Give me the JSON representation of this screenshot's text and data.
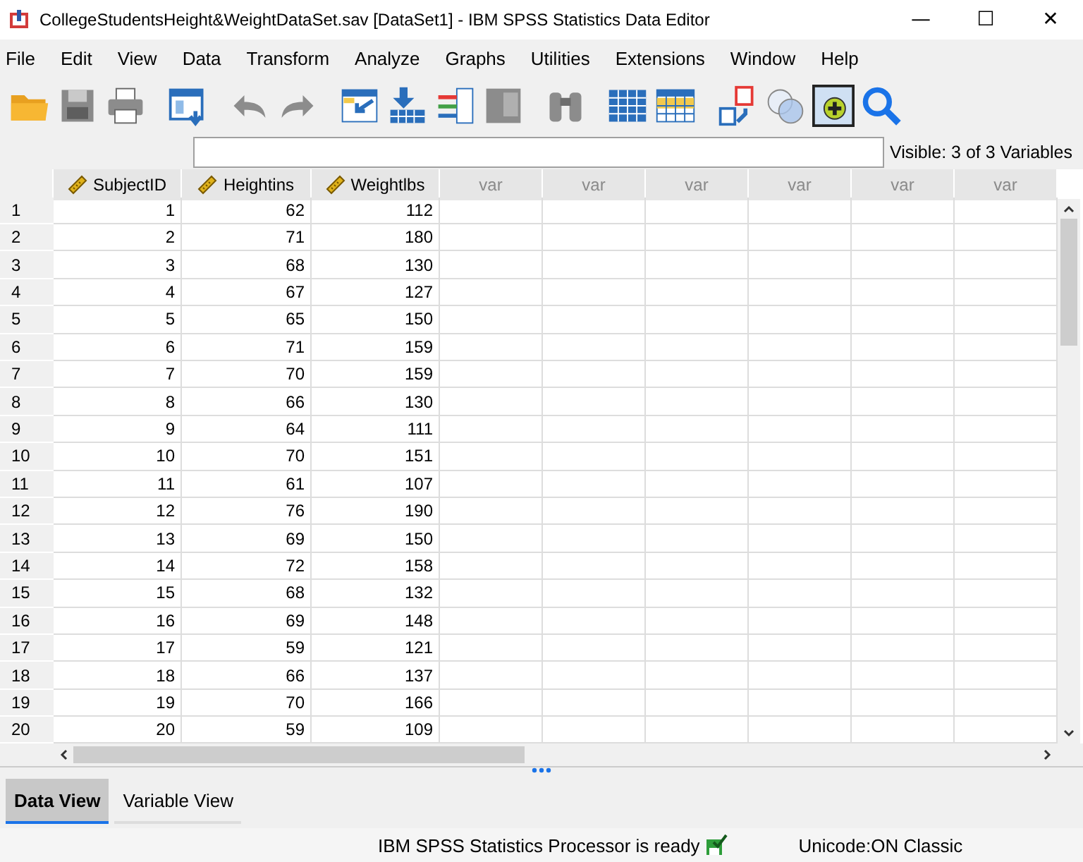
{
  "window": {
    "title": "CollegeStudentsHeight&WeightDataSet.sav [DataSet1] - IBM SPSS Statistics Data Editor",
    "controls": [
      "—",
      "☐",
      "✕"
    ]
  },
  "menu": [
    "File",
    "Edit",
    "View",
    "Data",
    "Transform",
    "Analyze",
    "Graphs",
    "Utilities",
    "Extensions",
    "Window",
    "Help"
  ],
  "cell_editor": {
    "visible_label": "Visible: 3 of 3 Variables"
  },
  "table": {
    "columns": [
      {
        "name": "SubjectID",
        "kind": "variable"
      },
      {
        "name": "Heightins",
        "kind": "variable"
      },
      {
        "name": "Weightlbs",
        "kind": "variable"
      },
      {
        "name": "var",
        "kind": "empty"
      },
      {
        "name": "var",
        "kind": "empty"
      },
      {
        "name": "var",
        "kind": "empty"
      },
      {
        "name": "var",
        "kind": "empty"
      },
      {
        "name": "var",
        "kind": "empty"
      },
      {
        "name": "var",
        "kind": "empty"
      }
    ],
    "rows": [
      {
        "n": "1",
        "cells": [
          "1",
          "62",
          "112"
        ]
      },
      {
        "n": "2",
        "cells": [
          "2",
          "71",
          "180"
        ]
      },
      {
        "n": "3",
        "cells": [
          "3",
          "68",
          "130"
        ]
      },
      {
        "n": "4",
        "cells": [
          "4",
          "67",
          "127"
        ]
      },
      {
        "n": "5",
        "cells": [
          "5",
          "65",
          "150"
        ]
      },
      {
        "n": "6",
        "cells": [
          "6",
          "71",
          "159"
        ]
      },
      {
        "n": "7",
        "cells": [
          "7",
          "70",
          "159"
        ]
      },
      {
        "n": "8",
        "cells": [
          "8",
          "66",
          "130"
        ]
      },
      {
        "n": "9",
        "cells": [
          "9",
          "64",
          "111"
        ]
      },
      {
        "n": "10",
        "cells": [
          "10",
          "70",
          "151"
        ]
      },
      {
        "n": "11",
        "cells": [
          "11",
          "61",
          "107"
        ]
      },
      {
        "n": "12",
        "cells": [
          "12",
          "76",
          "190"
        ]
      },
      {
        "n": "13",
        "cells": [
          "13",
          "69",
          "150"
        ]
      },
      {
        "n": "14",
        "cells": [
          "14",
          "72",
          "158"
        ]
      },
      {
        "n": "15",
        "cells": [
          "15",
          "68",
          "132"
        ]
      },
      {
        "n": "16",
        "cells": [
          "16",
          "69",
          "148"
        ]
      },
      {
        "n": "17",
        "cells": [
          "17",
          "59",
          "121"
        ]
      },
      {
        "n": "18",
        "cells": [
          "18",
          "66",
          "137"
        ]
      },
      {
        "n": "19",
        "cells": [
          "19",
          "70",
          "166"
        ]
      },
      {
        "n": "20",
        "cells": [
          "20",
          "59",
          "109"
        ]
      }
    ]
  },
  "view_tabs": [
    {
      "label": "Data View",
      "selected": true
    },
    {
      "label": "Variable View",
      "selected": false
    }
  ],
  "status_bar": {
    "processor": "IBM SPSS Statistics Processor is ready",
    "encoding": "Unicode:ON Classic"
  }
}
